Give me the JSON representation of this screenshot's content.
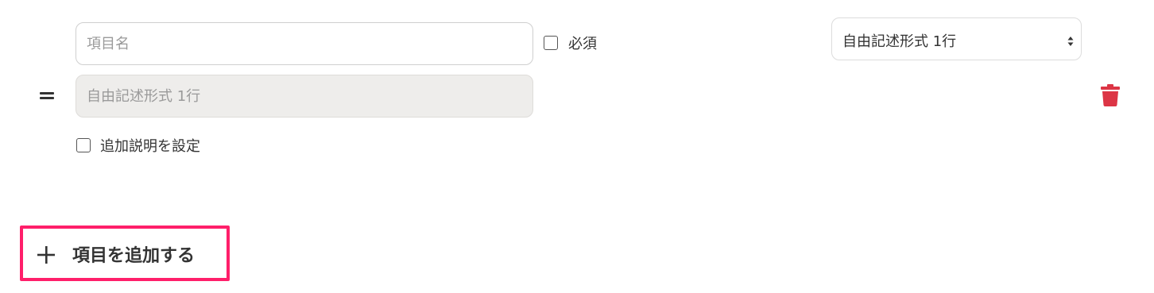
{
  "field": {
    "name_placeholder": "項目名",
    "name_value": "",
    "required_label": "必須",
    "required_checked": false,
    "type_preview_placeholder": "自由記述形式 1行",
    "description_label": "追加説明を設定",
    "description_checked": false,
    "type_select": {
      "selected": "自由記述形式 1行"
    }
  },
  "icons": {
    "drag": "drag-handle-icon",
    "delete": "trash-icon",
    "add": "plus-icon",
    "select": "select-arrows-icon"
  },
  "add_button": {
    "label": "項目を追加する"
  },
  "colors": {
    "delete_icon": "#dc3545",
    "highlight_border": "#ff1f6a",
    "disabled_input_bg": "#eeedeb"
  }
}
